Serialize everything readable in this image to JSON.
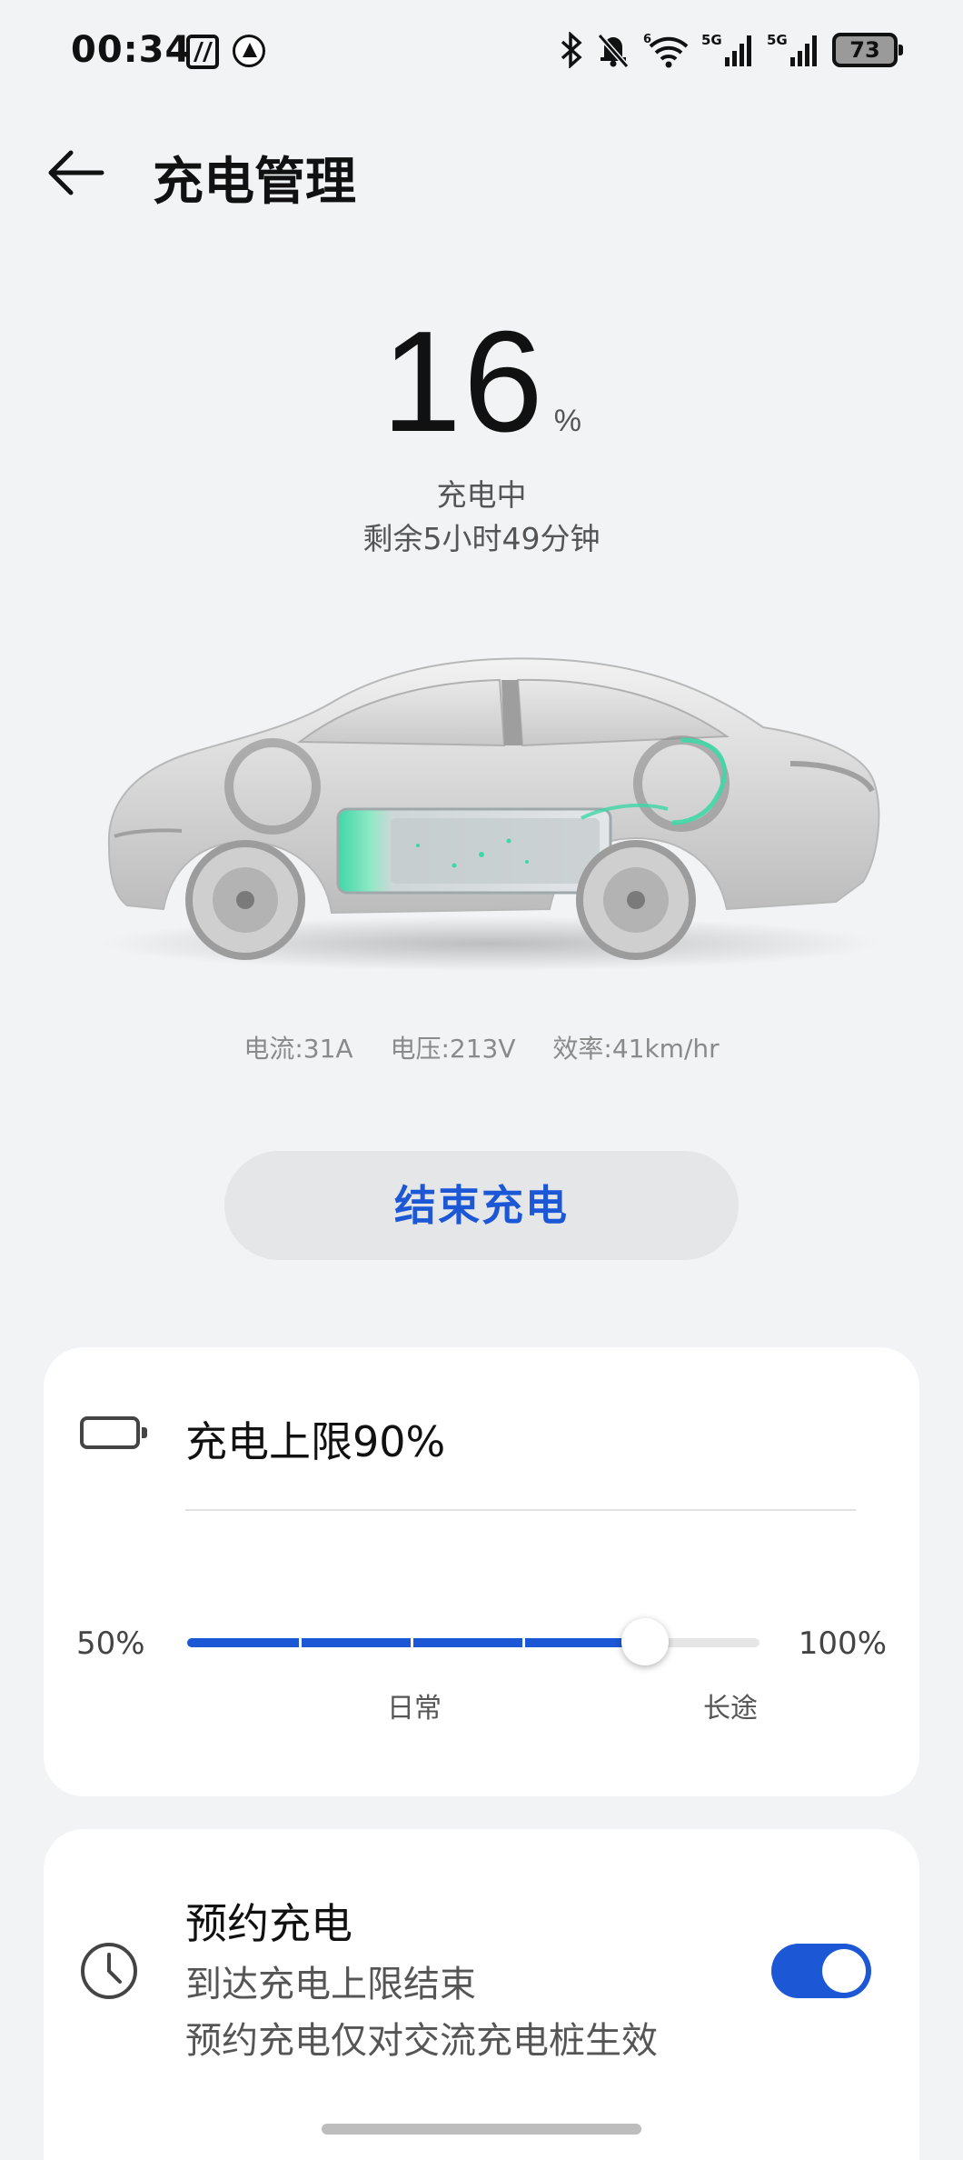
{
  "status_bar": {
    "time": "00:34",
    "icons": [
      "nfc-icon",
      "app-notification-icon",
      "bluetooth-icon",
      "mute-bell-icon",
      "wifi-icon",
      "5g-signal-icon",
      "5g-signal-icon"
    ],
    "battery_level": "73"
  },
  "header": {
    "back_icon": "back-arrow-icon",
    "title": "充电管理"
  },
  "charge": {
    "percent": "16",
    "unit": "%",
    "state": "充电中",
    "remaining": "剩余5小时49分钟"
  },
  "metrics": {
    "current": "电流:31A",
    "voltage": "电压:213V",
    "efficiency": "效率:41km/hr"
  },
  "end_button": "结束充电",
  "limit_card": {
    "icon": "battery-icon",
    "title": "充电上限90%",
    "slider": {
      "min_label": "50%",
      "max_label": "100%",
      "value_fraction": 0.8,
      "daily_label": "日常",
      "long_label": "长途"
    }
  },
  "schedule_card": {
    "icon": "clock-icon",
    "title": "预约充电",
    "subtitle": "到达充电上限结束",
    "note": "预约充电仅对交流充电桩生效",
    "toggle_on": true
  },
  "colors": {
    "accent": "#1c57d6",
    "background": "#f1f3f5",
    "card": "#ffffff"
  }
}
